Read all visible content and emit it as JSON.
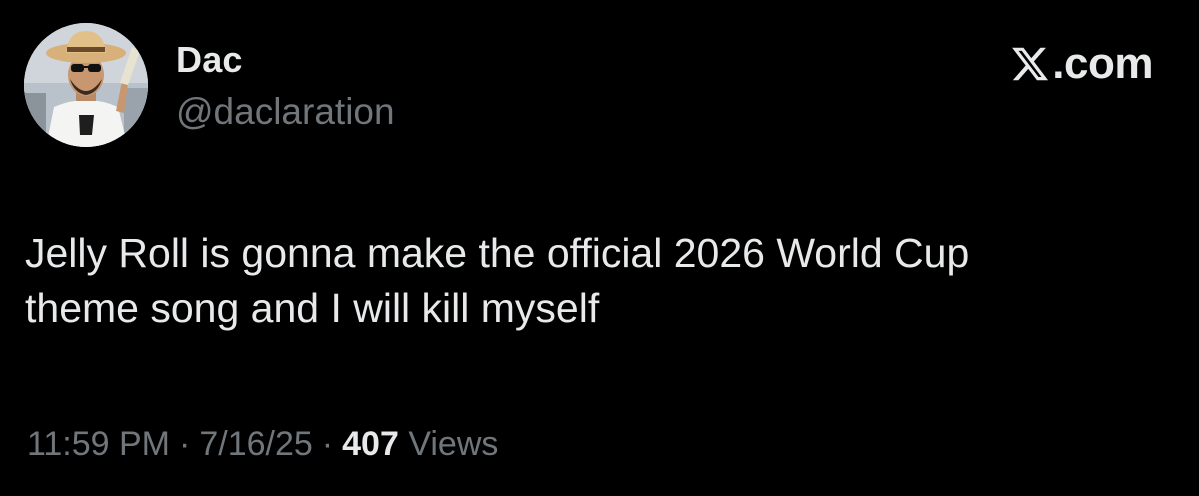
{
  "user": {
    "display_name": "Dac",
    "handle": "@daclaration",
    "avatar_icon": "profile-photo"
  },
  "brand": {
    "icon": "x-logo-icon",
    "text": ".com"
  },
  "tweet": {
    "text": "Jelly Roll is gonna make the official 2026 World Cup\ntheme song and I will kill myself"
  },
  "meta": {
    "time": "11:59 PM",
    "separator": "·",
    "date": "7/16/25",
    "views_count": "407",
    "views_label": "Views"
  },
  "colors": {
    "background": "#000000",
    "primary_text": "#e7e9ea",
    "secondary_text": "#71767b"
  }
}
